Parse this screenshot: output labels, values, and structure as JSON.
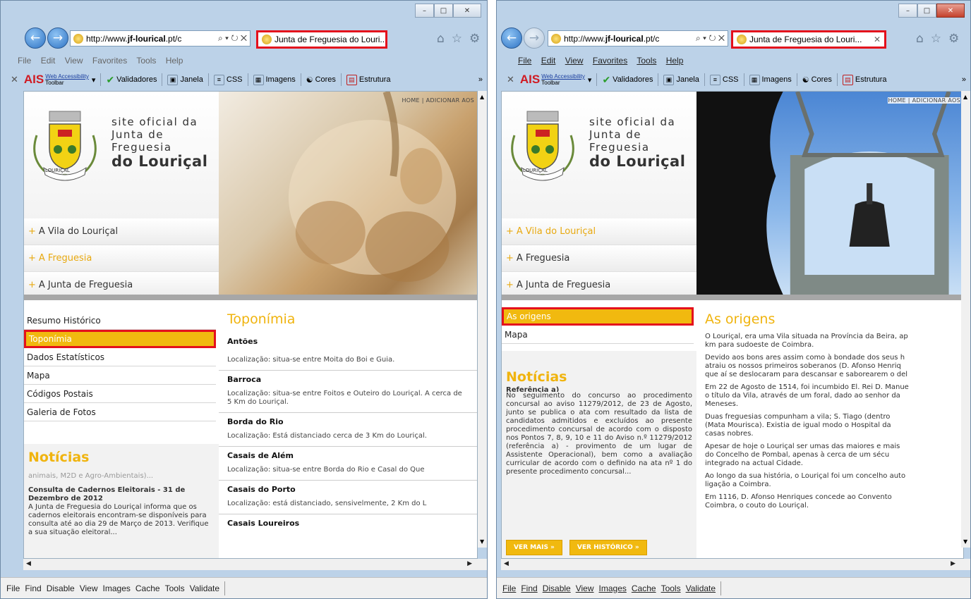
{
  "browser": {
    "url_prefix": "http://www.",
    "url_bold": "jf-lourical",
    "url_suffix": ".pt/c",
    "addr_controls": "⌕ ▾ ↻ ✕",
    "tab_title": "Junta de Freguesia do Louri...",
    "tab_close": "✕",
    "menu": [
      "File",
      "Edit",
      "View",
      "Favorites",
      "Tools",
      "Help"
    ],
    "toolbar": {
      "close": "✕",
      "ais": "AIS",
      "ais_line1": "Web Accessibility",
      "ais_line2": "Toolbar",
      "items": [
        "Validadores",
        "Janela",
        "CSS",
        "Imagens",
        "Cores",
        "Estrutura"
      ],
      "more": "»"
    },
    "status": [
      "File",
      "Find",
      "Disable",
      "View",
      "Images",
      "Cache",
      "Tools",
      "Validate"
    ],
    "window_buttons": {
      "min": "–",
      "max": "□",
      "close": "✕"
    }
  },
  "site": {
    "tagline1": "site oficial da",
    "tagline2": "Junta de Freguesia",
    "tagline3_pre": "do ",
    "tagline3": "Louriçal",
    "crest_ribbon": "LOURIÇAL",
    "toplinks": "HOME | ADICIONAR AOS",
    "nav": [
      "A Vila do Louriçal",
      "A Freguesia",
      "A Junta de Freguesia"
    ],
    "plus": "+",
    "noticias": "Notícias"
  },
  "left": {
    "subnav": [
      "Resumo Histórico",
      "Toponímia",
      "Dados Estatísticos",
      "Mapa",
      "Códigos Postais",
      "Galeria de Fotos"
    ],
    "news_top": "animais, M2D e Agro-Ambientais)...",
    "news_title": "Consulta de Cadernos Eleitorais - 31 de Dezembro de 2012",
    "news_body": "A Junta de Freguesia do Louriçal informa que os cadernos eleitorais encontram-se disponíveis para consulta até ao dia 29 de Março de 2013. Verifique a sua situação eleitoral...",
    "heading": "Toponímia",
    "places": [
      {
        "name": "Antões",
        "desc": "Localização: situa-se entre Moita do Boi e Guia."
      },
      {
        "name": "Barroca",
        "desc": "Localização: situa-se entre Foitos e Outeiro do Louriçal. A cerca de 5 Km do Louriçal."
      },
      {
        "name": "Borda do Rio",
        "desc": "Localização: Está distanciado cerca de 3 Km do Louriçal."
      },
      {
        "name": "Casais de Além",
        "desc": "Localização: situa-se entre Borda do Rio e Casal do Que"
      },
      {
        "name": "Casais do Porto",
        "desc": "Localização: está distanciado, sensivelmente, 2 Km do L"
      },
      {
        "name": "Casais Loureiros",
        "desc": ""
      }
    ]
  },
  "right": {
    "subnav": [
      "As origens",
      "Mapa"
    ],
    "news_top": "Referência a)",
    "news_body": "No seguimento do concurso ao procedimento concursal ao aviso 11279/2012, de 23 de Agosto, junto se publica o ata com resultado da lista de candidatos admitidos e excluídos ao presente procedimento concursal de acordo com o disposto nos Pontos 7, 8, 9, 10 e 11 do Aviso n.º 11279/2012 (referência a) - provimento de um lugar de Assistente Operacional), bem como a avaliação curricular de acordo com o definido na ata nº 1 do presente procedimento concursal...",
    "btn_more": "VER MAIS   »",
    "btn_history": "VER HISTÓRICO »",
    "heading": "As origens",
    "paras": [
      "O Louriçal, era uma Vila situada na Província da Beira, ap",
      "km para sudoeste de Coimbra.",
      "Devido aos bons ares assim como à bondade dos seus h",
      "atraiu os nossos primeiros soberanos (D. Afonso Henriq",
      "que aí se deslocaram para descansar e saborearem o del",
      "Em 22 de Agosto de 1514, foi incumbido El. Rei D. Manue",
      "o título da Vila, através de um foral, dado ao senhor da",
      "Meneses.",
      "Duas freguesias compunham a vila; S. Tiago (dentro",
      "(Mata Mourisca). Existia de igual modo o Hospital da",
      "casas nobres.",
      "Apesar de hoje o Louriçal ser umas das maiores e mais",
      "do Concelho de Pombal, apenas à cerca de um sécu",
      "integrado na actual Cidade.",
      "Ao longo da sua história, o Louriçal foi um concelho auto",
      "ligação a Coimbra.",
      "Em 1116, D. Afonso Henriques concede ao Convento",
      "Coimbra, o couto do Louriçal."
    ]
  },
  "scroll": {
    "up": "▲",
    "down": "▼",
    "left": "◀",
    "right": "▶"
  },
  "colors": {
    "accent": "#f0b40f",
    "highlight_box": "#e4101c"
  }
}
